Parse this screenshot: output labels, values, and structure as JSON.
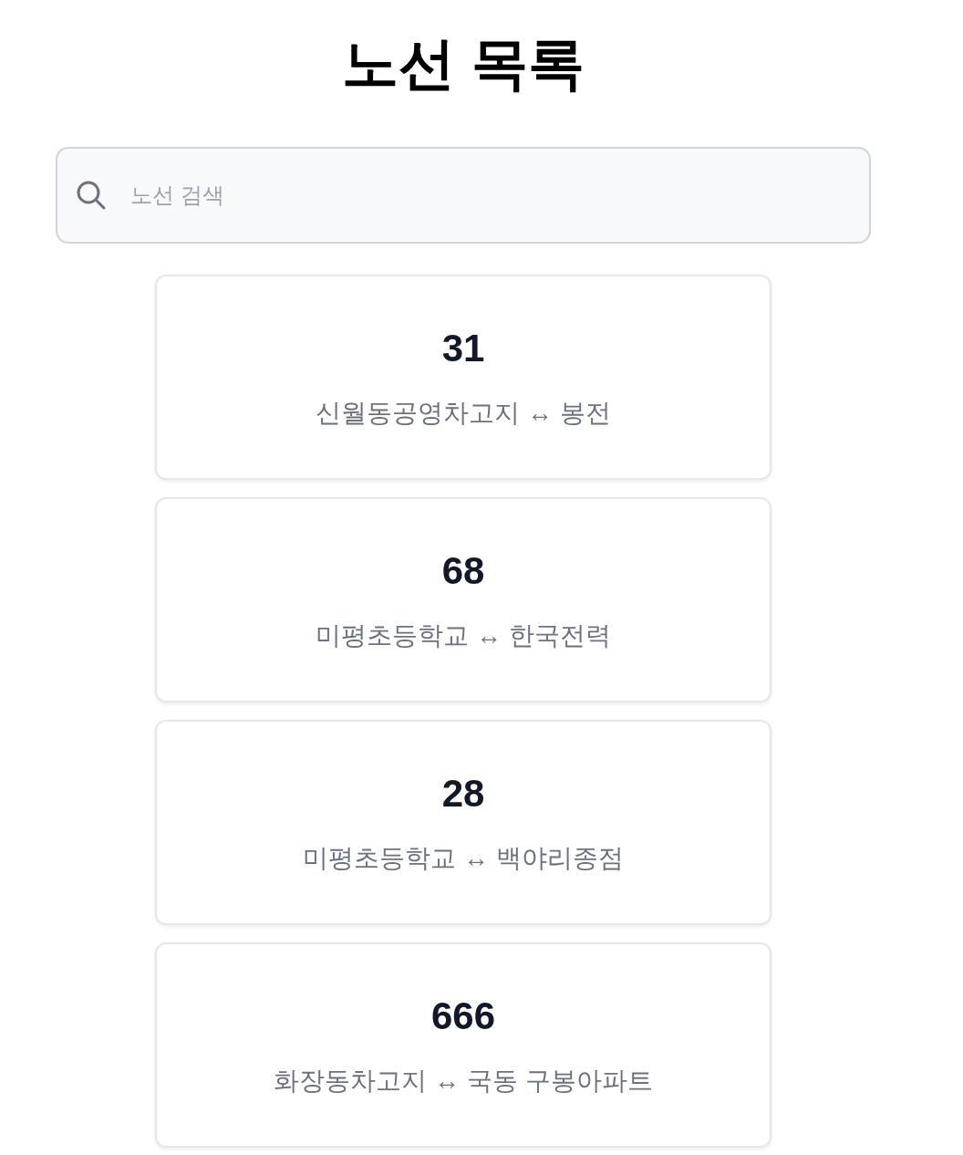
{
  "title": "노선 목록",
  "search": {
    "placeholder": "노선 검색"
  },
  "routes": [
    {
      "number": "31",
      "route": "신월동공영차고지 ↔ 봉전"
    },
    {
      "number": "68",
      "route": "미평초등학교 ↔ 한국전력"
    },
    {
      "number": "28",
      "route": "미평초등학교 ↔ 백야리종점"
    },
    {
      "number": "666",
      "route": "화장동차고지 ↔ 국동 구봉아파트"
    }
  ]
}
